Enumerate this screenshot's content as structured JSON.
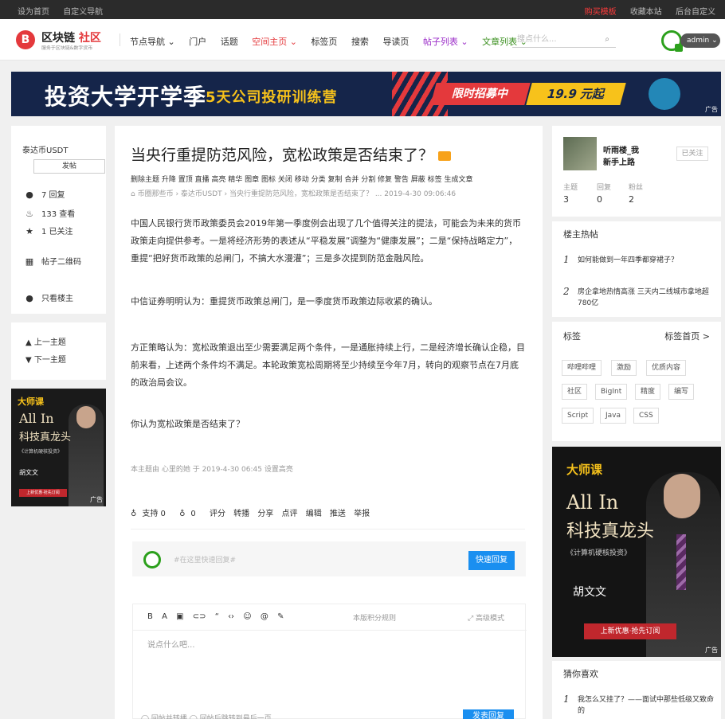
{
  "topbar": {
    "left": [
      "设为首页",
      "自定义导航"
    ],
    "right": [
      "购买模板",
      "收藏本站",
      "后台自定义"
    ]
  },
  "header": {
    "logo_mark": "B",
    "logo_name_a": "区块链",
    "logo_name_b": "社区",
    "logo_sub": "服务于区块链&数字货币",
    "nav": [
      "节点导航 ⌄",
      "门户",
      "话题",
      "空间主页 ⌄",
      "标签页",
      "搜索",
      "导读页",
      "帖子列表 ⌄",
      "文章列表 ⌄"
    ],
    "search_placeholder": "搜点什么...",
    "user": "admin"
  },
  "banner": {
    "title": "投资大学开学季",
    "subtitle": "5天公司投研训练营",
    "tag": "限时招募中",
    "price": "19.9 元起",
    "ad": "广告"
  },
  "left": {
    "board": "泰达币USDT",
    "post_button": "发帖",
    "stats": [
      "7 回复",
      "133 查看",
      "1 已关注"
    ],
    "qrcode": "帖子二维码",
    "only_author": "只看楼主",
    "prev": "上一主题",
    "next": "下一主题",
    "ad": {
      "brand": "大师课",
      "line1": "All In",
      "line2": "科技真龙头",
      "line3": "《计算机硬核投资》",
      "name": "胡文文",
      "cta": "上新优惠·抢先订阅",
      "tag": "广告"
    }
  },
  "post": {
    "title": "当央行重提防范风险，宽松政策是否结束了？",
    "admin_links": "删除主题 升降 置顶 直播 高亮 精华 图章 图标 关闭 移动 分类 复制 合并 分割 修复 警告 屏蔽 标签 生成文章",
    "breadcrumb": "币圈那些币 › 泰达币USDT › 当央行重提防范风险，宽松政策是否结束了？ ...   2019-4-30 09:06:46",
    "paragraphs": [
      "中国人民银行货币政策委员会2019年第一季度例会出现了几个值得关注的提法，可能会为未来的货币政策走向提供参考。一是将经济形势的表述从“平稳发展”调整为“健康发展”；二是“保持战略定力”，重提“把好货币政策的总闸门，不搞大水漫灌”；三是多次提到防范金融风险。",
      "中信证券明明认为：重提货币政策总闸门，是一季度货币政策边际收紧的确认。",
      "方正策略认为：宽松政策退出至少需要满足两个条件，一是通胀持续上行，二是经济增长确认企稳，目前来看，上述两个条件均不满足。本轮政策宽松周期将至少持续至今年7月，转向的观察节点在7月底的政治局会议。",
      "你认为宽松政策是否结束了？"
    ],
    "highlight_note": "本主题由 心里的她 于 2019-4-30 06:45 设置高亮",
    "actions": [
      "支持 0",
      "0",
      "评分",
      "转播",
      "分享",
      "点评",
      "编辑",
      "推送",
      "举报"
    ],
    "quick_reply_placeholder": "#在这里快速回复#",
    "quick_reply_button": "快速回复",
    "editor_toolbar": [
      "B",
      "A",
      "▣",
      "⊂⊃",
      "“",
      "‹›",
      "☺",
      "@",
      "✎"
    ],
    "editor_rule": "本版积分规则",
    "editor_adv": "⤢ 高级模式",
    "editor_placeholder": "说点什么吧...",
    "editor_bottom": "◯ 回帖并转播  ◯ 回帖后跳转到最后一页",
    "editor_send": "发表回复"
  },
  "right": {
    "author_name": "听雨楼_我",
    "author_level": "新手上路",
    "followed": "已关注",
    "stats": [
      {
        "label": "主题",
        "value": "3"
      },
      {
        "label": "回复",
        "value": "0"
      },
      {
        "label": "粉丝",
        "value": "2"
      }
    ],
    "hot_title": "楼主热帖",
    "hot": [
      {
        "n": "1",
        "t": "如何能做到一年四季都穿裙子？"
      },
      {
        "n": "2",
        "t": "房企拿地热情高涨 三天内二线城市拿地超780亿"
      }
    ],
    "tags_title": "标签",
    "tags_link": "标签首页 >",
    "tags": [
      "哔哩哔哩",
      "激励",
      "优质内容",
      "社区",
      "BigInt",
      "精度",
      "编写",
      "Script",
      "Java",
      "CSS"
    ],
    "guess_title": "猜你喜欢",
    "guess": [
      {
        "n": "1",
        "t": "我怎么又挂了？——面试中那些低级又致命的"
      }
    ]
  }
}
